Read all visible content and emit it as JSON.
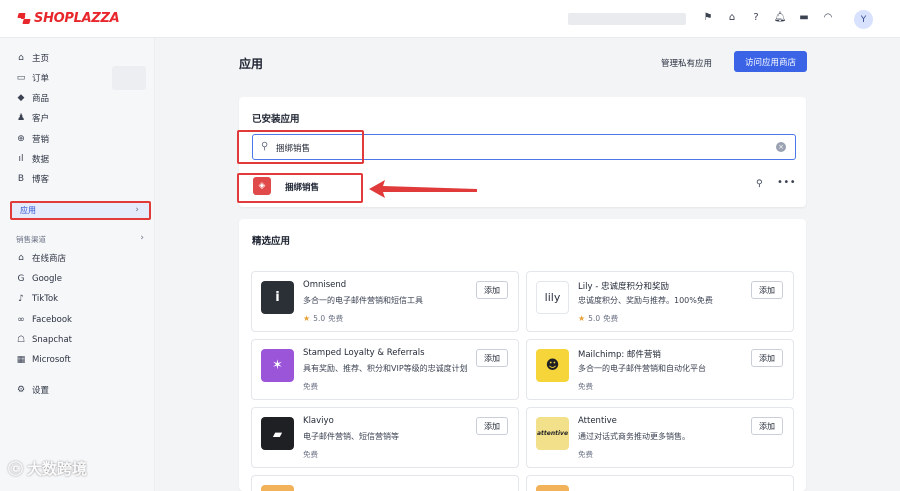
{
  "brand": {
    "name": "SHOPLAZZA",
    "color": "#e8272c"
  },
  "topbar": {
    "icons": [
      "flag-icon",
      "store-icon",
      "help-icon",
      "bell-icon",
      "chat-icon",
      "wifi-icon"
    ],
    "avatar_initial": "Y"
  },
  "sidebar": {
    "items": [
      {
        "label": "主页",
        "icon": "home-icon",
        "glyph": "⌂"
      },
      {
        "label": "订单",
        "icon": "orders-icon",
        "glyph": "▭"
      },
      {
        "label": "商品",
        "icon": "tag-icon",
        "glyph": "◆"
      },
      {
        "label": "客户",
        "icon": "person-icon",
        "glyph": "♟"
      },
      {
        "label": "营销",
        "icon": "marketing-icon",
        "glyph": "⊕"
      },
      {
        "label": "数据",
        "icon": "chart-icon",
        "glyph": "ıl"
      },
      {
        "label": "博客",
        "icon": "blog-icon",
        "glyph": "B"
      }
    ],
    "active": {
      "label": "应用"
    },
    "sales_channels_label": "销售渠道",
    "channels": [
      {
        "label": "在线商店",
        "icon": "storefront-icon",
        "glyph": "⌂"
      },
      {
        "label": "Google",
        "icon": "google-icon",
        "glyph": "G"
      },
      {
        "label": "TikTok",
        "icon": "tiktok-icon",
        "glyph": "♪"
      },
      {
        "label": "Facebook",
        "icon": "meta-icon",
        "glyph": "∞"
      },
      {
        "label": "Snapchat",
        "icon": "snapchat-icon",
        "glyph": "☖"
      },
      {
        "label": "Microsoft",
        "icon": "microsoft-icon",
        "glyph": "▦"
      }
    ],
    "settings_label": "设置"
  },
  "header": {
    "title": "应用",
    "private_apps_link": "管理私有应用",
    "visit_store_button": "访问应用商店",
    "accent": "#3a63e6"
  },
  "installed": {
    "title": "已安装应用",
    "search_value": "捆绑销售",
    "result_name": "捆绑销售"
  },
  "featured": {
    "title": "精选应用",
    "add_label": "添加",
    "apps": [
      {
        "name": "Omnisend",
        "desc": "多合一的电子邮件营销和短信工具",
        "rating": "5.0",
        "price": "免费",
        "logo_text": "i",
        "logo_color": "#2b2f36"
      },
      {
        "name": "Lily - 忠诚度积分和奖励",
        "desc": "忠诚度积分、奖励与推荐。100%免费",
        "rating": "5.0",
        "price": "免费",
        "logo_text": "lily",
        "logo_color": "#ffffff"
      },
      {
        "name": "Stamped Loyalty & Referrals",
        "desc": "具有奖励、推荐、积分和VIP等级的忠诚度计划",
        "rating": "",
        "price": "免费",
        "logo_text": "✶",
        "logo_color": "#9b55d8"
      },
      {
        "name": "Mailchimp: 邮件营销",
        "desc": "多合一的电子邮件营销和自动化平台",
        "rating": "",
        "price": "免费",
        "logo_text": "☻",
        "logo_color": "#f5d53a"
      },
      {
        "name": "Klaviyo",
        "desc": "电子邮件营销、短信营销等",
        "rating": "",
        "price": "免费",
        "logo_text": "▰",
        "logo_color": "#1f2024"
      },
      {
        "name": "Attentive",
        "desc": "通过对话式商务推动更多销售。",
        "rating": "",
        "price": "免费",
        "logo_text": "attentive",
        "logo_color": "#f3e08a"
      }
    ]
  },
  "watermark": "大数跨境"
}
